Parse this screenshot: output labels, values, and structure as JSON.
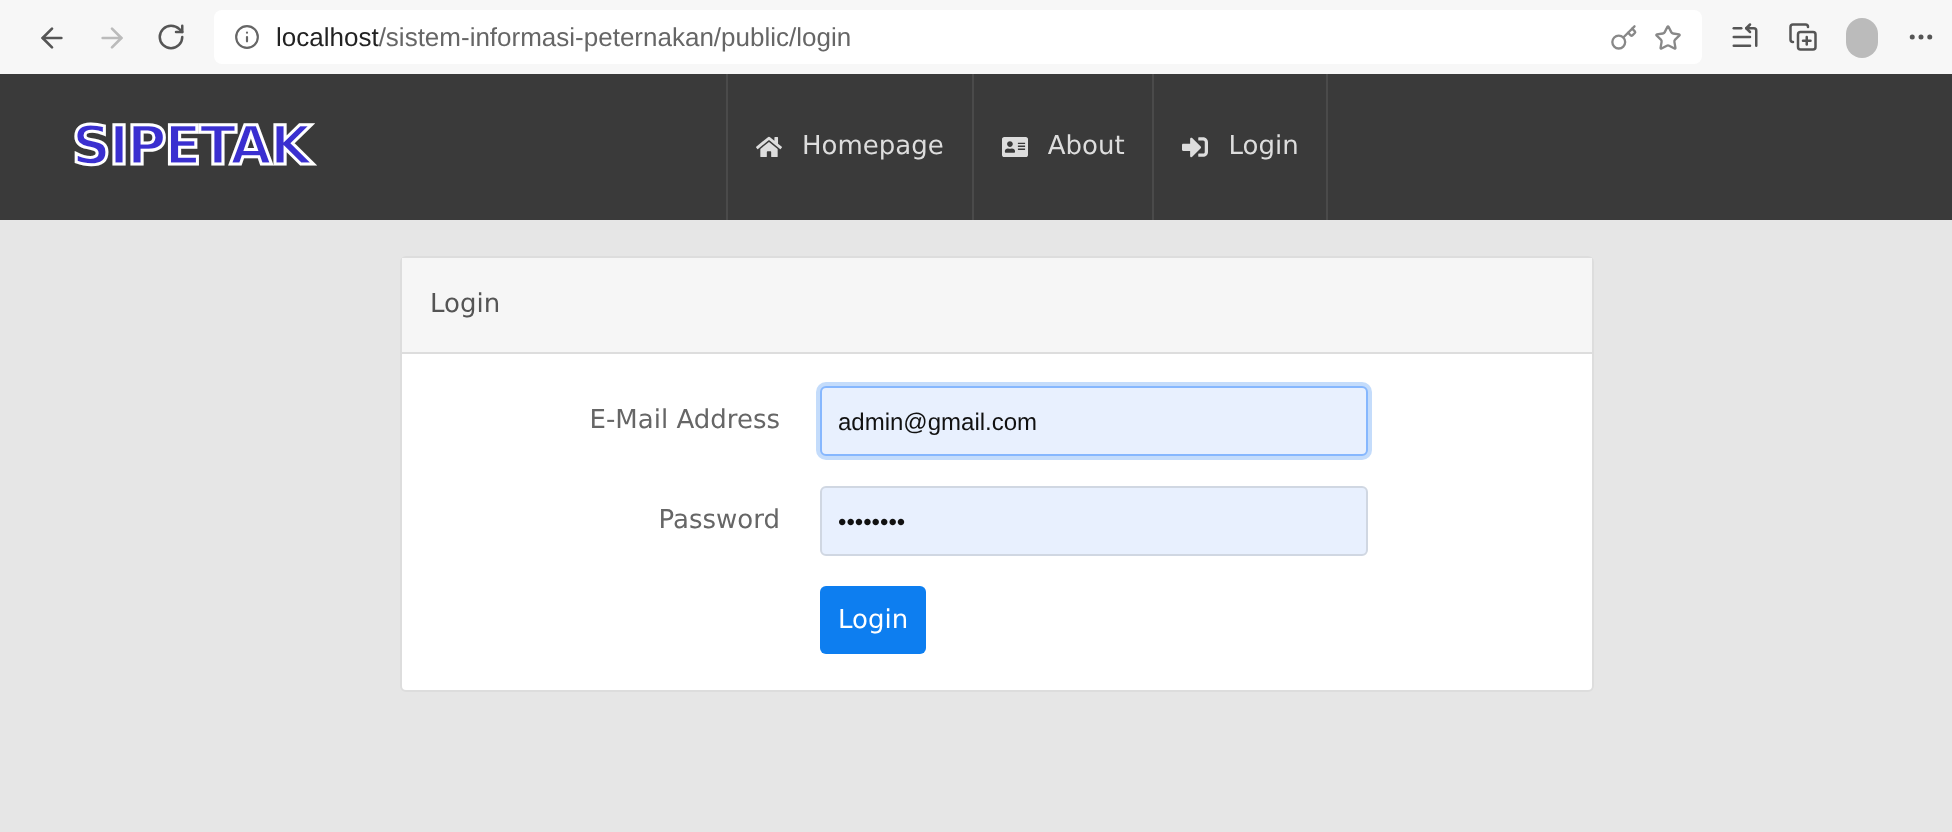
{
  "browser": {
    "url": "**localhost**/sistem-informasi-peternakan/public/login"
  },
  "navbar": {
    "brand": "SIPETAK",
    "links": [
      {
        "label": "Homepage",
        "kind": "home"
      },
      {
        "label": "About",
        "kind": "card"
      },
      {
        "label": "Login",
        "kind": "signin"
      }
    ]
  },
  "card": {
    "title": "Login",
    "fields": [
      {
        "label": "E-Mail Address",
        "value": "admin@gmail.com",
        "focused": true
      },
      {
        "label": "Password",
        "value": "••••••••",
        "focused": false
      }
    ],
    "button": "Login"
  }
}
